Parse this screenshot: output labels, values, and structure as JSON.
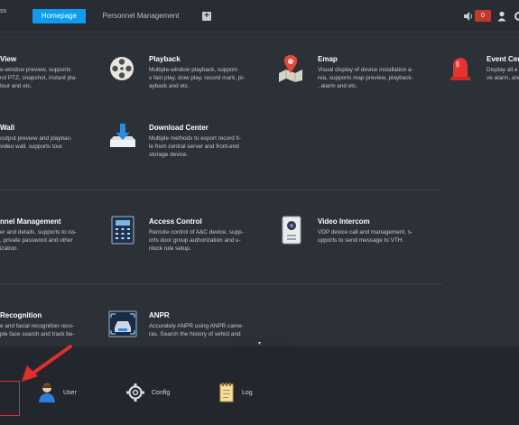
{
  "topbar": {
    "brand_fragment": "ss",
    "tabs": [
      {
        "label": "Homepage"
      },
      {
        "label": "Personnel Management"
      }
    ],
    "add_tab_symbol": "+",
    "alarm_count": "0"
  },
  "modules": [
    {
      "title": "View",
      "desc": [
        "e-window preview, supports",
        "rol PTZ, snapshot, instant pla-",
        "tour and etc."
      ],
      "icon": "preview-icon"
    },
    {
      "title": "Playback",
      "desc": [
        "Multiple-window playback, support-",
        "s fast play, slow play, record mark, pl-",
        "ayback and etc."
      ],
      "icon": "film-reel-icon"
    },
    {
      "title": "Emap",
      "desc": [
        "Visual display of device installation a-",
        "rea, supports map preview, playback-",
        ", alarm and etc."
      ],
      "icon": "map-pin-icon"
    },
    {
      "title": "Event Cen",
      "desc": [
        "Display all e",
        "ve alarm, and"
      ],
      "icon": "alarm-light-icon"
    },
    {
      "title": "Wall",
      "desc": [
        "output preview and playbac-",
        "video wall, supports tour."
      ],
      "icon": "video-wall-icon"
    },
    {
      "title": "Download Center",
      "desc": [
        "Multiple methods to export record fi-",
        "le from central server and front-end",
        "storage device."
      ],
      "icon": "download-icon"
    },
    {
      "title": "nnel Management",
      "desc": [
        "er and details, supports to iss-",
        ", private password and other",
        "ization."
      ],
      "icon": "personnel-icon"
    },
    {
      "title": "Access Control",
      "desc": [
        "Remote control of A&C device, supp-",
        "orts door group authorization and u-",
        "nlock rule setup."
      ],
      "icon": "access-control-icon"
    },
    {
      "title": "Video Intercom",
      "desc": [
        "VDP device call and management, s-",
        "upports to send message to VTH."
      ],
      "icon": "intercom-icon"
    },
    {
      "title": "Recognition",
      "desc": [
        "e and facial recognition reco-",
        "ple face search and track be-"
      ],
      "icon": "face-recognition-icon"
    },
    {
      "title": "ANPR",
      "desc": [
        "Accurately ANPR using ANPR came-",
        "ras. Search the history of vehicl and"
      ],
      "icon": "anpr-camera-icon"
    }
  ],
  "collapse_symbol": "▾",
  "bottombar": {
    "items": [
      {
        "label": "User",
        "icon": "user-icon"
      },
      {
        "label": "Config",
        "icon": "gear-icon"
      },
      {
        "label": "Log",
        "icon": "log-icon"
      }
    ]
  },
  "colors": {
    "accent": "#0f9bf0",
    "background": "#2c3037",
    "annotation": "#e02d2d"
  }
}
